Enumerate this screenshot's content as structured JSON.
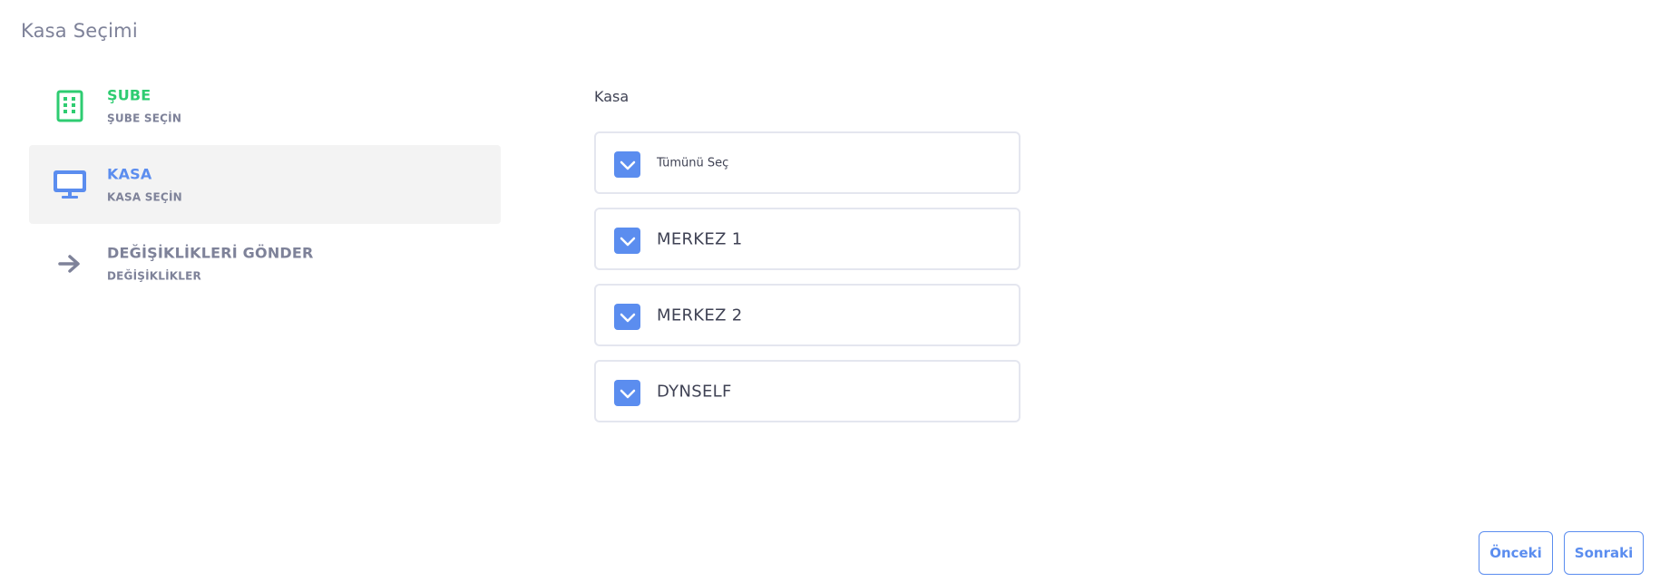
{
  "page": {
    "title": "Kasa Seçimi"
  },
  "steps": [
    {
      "title": "ŞUBE",
      "description": "ŞUBE SEÇİN",
      "icon": "building-icon",
      "status": "done",
      "color": "#2ecc71"
    },
    {
      "title": "KASA",
      "description": "KASA SEÇİN",
      "icon": "monitor-icon",
      "status": "active",
      "color": "#5b8def"
    },
    {
      "title": "DEĞİŞİKLİKLERİ GÖNDER",
      "description": "DEĞİŞİKLİKLER",
      "icon": "arrow-right-icon",
      "status": "pending",
      "color": "#7e8299"
    }
  ],
  "form": {
    "label": "Kasa",
    "options": [
      {
        "label": "Tümünü Seç",
        "checked": true
      },
      {
        "label": "MERKEZ 1",
        "checked": true
      },
      {
        "label": "MERKEZ 2",
        "checked": true
      },
      {
        "label": "DYNSELF",
        "checked": true
      }
    ]
  },
  "buttons": {
    "previous": "Önceki",
    "next": "Sonraki"
  },
  "colors": {
    "accent": "#5b8def",
    "success": "#2ecc71",
    "muted": "#7e8299"
  }
}
